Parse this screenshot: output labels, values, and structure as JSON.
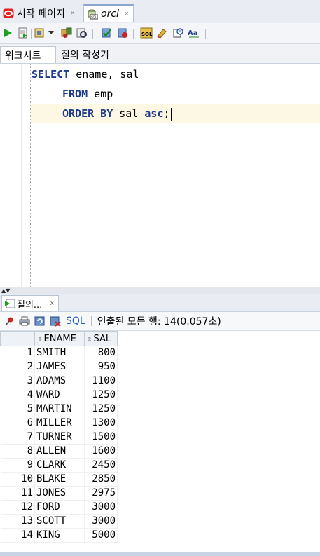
{
  "tabs": [
    {
      "label": "시작 페이지",
      "icon": "oracle-logo-icon",
      "close": "×"
    },
    {
      "label": "orcl",
      "icon": "sql-worksheet-icon",
      "close": "×"
    }
  ],
  "toolbar": {
    "icons": [
      "run-statement-icon",
      "run-script-icon",
      "autotrace-icon",
      "dropdown-arrow-icon",
      "explain-plan-icon",
      "sql-tuning-icon",
      "commit-icon",
      "rollback-icon",
      "unshared-sql-icon",
      "clear-icon",
      "history-icon",
      "format-case-icon"
    ]
  },
  "subtabs": [
    "워크시트",
    "질의 작성기"
  ],
  "editor": {
    "lines": [
      {
        "kw1": "SELECT",
        "rest": " ename, sal"
      },
      {
        "kw1": "FROM",
        "rest": " emp"
      },
      {
        "kw1": "ORDER BY",
        "mid": " sal ",
        "kw2": "asc",
        "tail": ";"
      }
    ]
  },
  "results": {
    "tab_label": "질의...",
    "tab_close": "x",
    "sql_link": "SQL",
    "fetch_status": "인출된 모든 행: 14(0.057초)",
    "columns": [
      "ENAME",
      "SAL"
    ],
    "rows": [
      {
        "n": "1",
        "ename": "SMITH",
        "sal": "800"
      },
      {
        "n": "2",
        "ename": "JAMES",
        "sal": "950"
      },
      {
        "n": "3",
        "ename": "ADAMS",
        "sal": "1100"
      },
      {
        "n": "4",
        "ename": "WARD",
        "sal": "1250"
      },
      {
        "n": "5",
        "ename": "MARTIN",
        "sal": "1250"
      },
      {
        "n": "6",
        "ename": "MILLER",
        "sal": "1300"
      },
      {
        "n": "7",
        "ename": "TURNER",
        "sal": "1500"
      },
      {
        "n": "8",
        "ename": "ALLEN",
        "sal": "1600"
      },
      {
        "n": "9",
        "ename": "CLARK",
        "sal": "2450"
      },
      {
        "n": "10",
        "ename": "BLAKE",
        "sal": "2850"
      },
      {
        "n": "11",
        "ename": "JONES",
        "sal": "2975"
      },
      {
        "n": "12",
        "ename": "FORD",
        "sal": "3000"
      },
      {
        "n": "13",
        "ename": "SCOTT",
        "sal": "3000"
      },
      {
        "n": "14",
        "ename": "KING",
        "sal": "5000"
      }
    ]
  },
  "colors": {
    "keyword": "#1f3c8a",
    "sql_link": "#2b5fbf",
    "current_line": "#fdf8e4"
  }
}
